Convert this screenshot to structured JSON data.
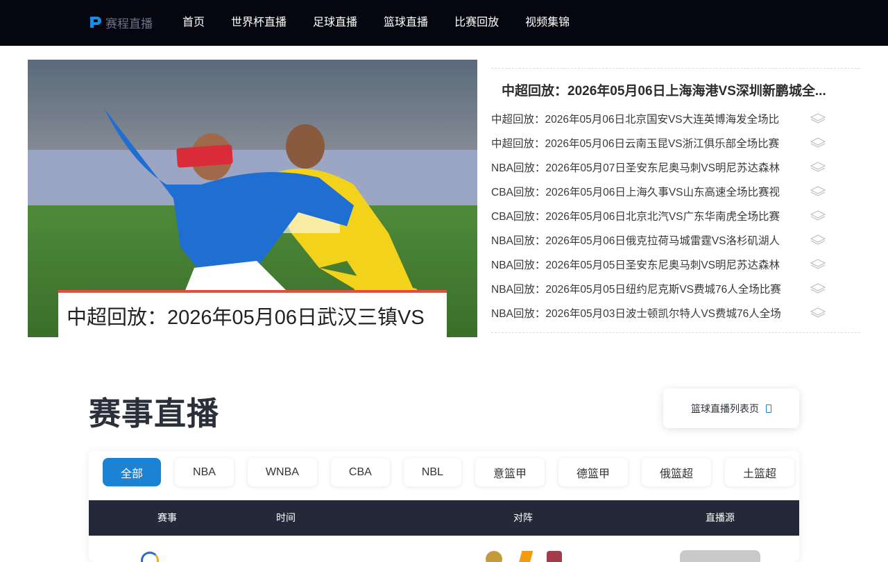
{
  "site": {
    "logo_text": "赛程直播"
  },
  "nav": [
    "首页",
    "世界杯直播",
    "足球直播",
    "篮球直播",
    "比赛回放",
    "视频集锦"
  ],
  "hero": {
    "caption": "中超回放：2026年05月06日武汉三镇VS"
  },
  "news": {
    "headline": "中超回放：2026年05月06日上海海港VS深圳新鹏城全...",
    "items": [
      "中超回放：2026年05月06日北京国安VS大连英博海发全场比",
      "中超回放：2026年05月06日云南玉昆VS浙江俱乐部全场比赛",
      "NBA回放：2026年05月07日圣安东尼奥马刺VS明尼苏达森林",
      "CBA回放：2026年05月06日上海久事VS山东高速全场比赛视",
      "CBA回放：2026年05月06日北京北汽VS广东华南虎全场比赛",
      "NBA回放：2026年05月06日俄克拉荷马城雷霆VS洛杉矶湖人",
      "NBA回放：2026年05月05日圣安东尼奥马刺VS明尼苏达森林",
      "NBA回放：2026年05月05日纽约尼克斯VS费城76人全场比赛",
      "NBA回放：2026年05月03日波士顿凯尔特人VS费城76人全场"
    ],
    "item_icon": "layers-icon"
  },
  "section": {
    "title": "赛事直播",
    "list_link": "篮球直播列表页"
  },
  "tabs": [
    "全部",
    "NBA",
    "WNBA",
    "CBA",
    "NBL",
    "意篮甲",
    "德篮甲",
    "俄篮超",
    "土篮超"
  ],
  "active_tab": "全部",
  "table": {
    "headers": {
      "event": "赛事",
      "time": "时间",
      "match": "对阵",
      "source": "直播源"
    }
  },
  "colors": {
    "topbar_bg": "#05060f",
    "accent_blue": "#1c82d4",
    "caption_red": "#e74c3c",
    "table_head_bg": "#232938"
  }
}
